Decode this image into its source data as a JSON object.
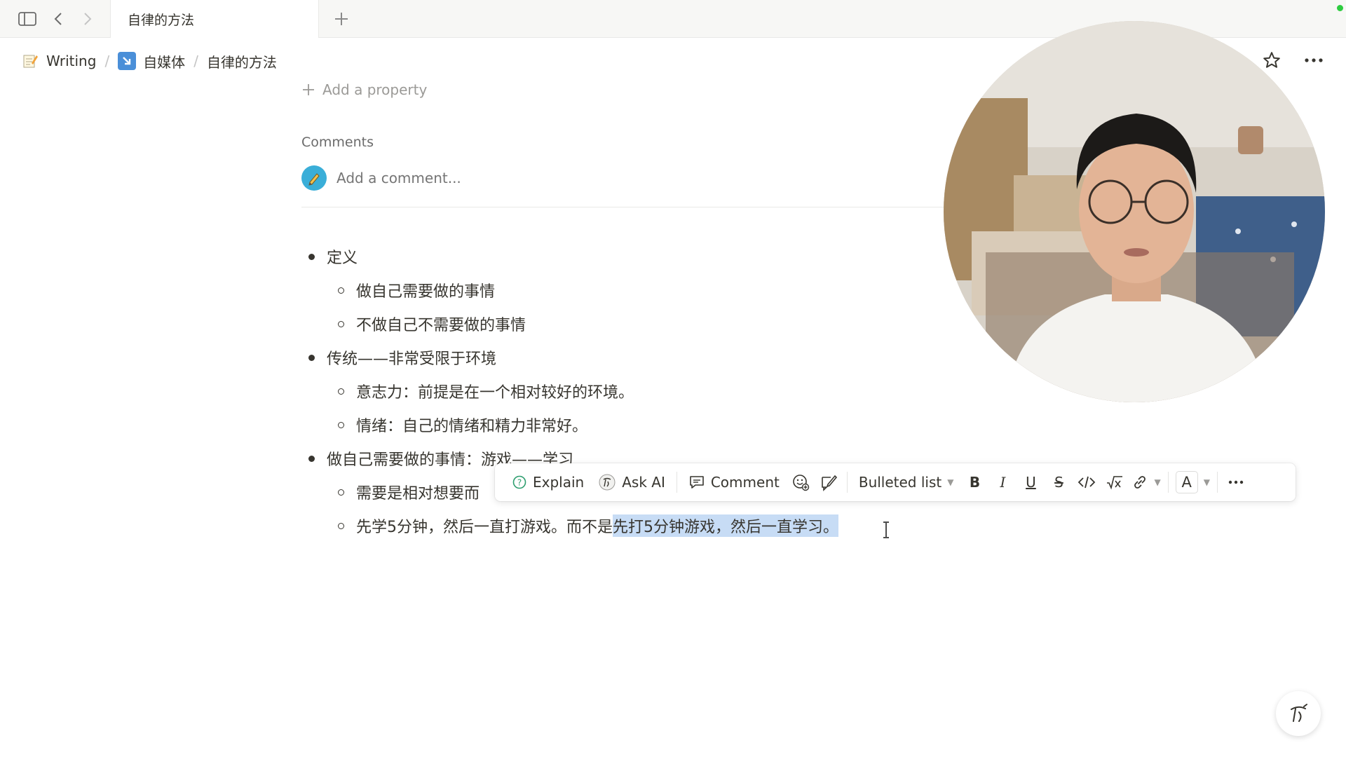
{
  "tab": {
    "title": "自律的方法"
  },
  "breadcrumb": [
    {
      "label": "Writing",
      "icon": "memo-icon"
    },
    {
      "label": "自媒体",
      "icon": "arrow-box-icon"
    },
    {
      "label": "自律的方法"
    }
  ],
  "properties": {
    "add_label": "Add a property"
  },
  "comments": {
    "label": "Comments",
    "placeholder": "Add a comment..."
  },
  "outline": {
    "item1": "定义",
    "item1_1": "做自己需要做的事情",
    "item1_2": "不做自己不需要做的事情",
    "item2": "传统——非常受限于环境",
    "item2_1": "意志力：前提是在一个相对较好的环境。",
    "item2_2": "情绪：自己的情绪和精力非常好。",
    "item3": "做自己需要做的事情：游戏——学习",
    "item3_1": "需要是相对想要而",
    "item3_2_plain": "先学5分钟，然后一直打游戏。而不是",
    "item3_2_selected": "先打5分钟游戏，然后一直学习。"
  },
  "toolbar": {
    "explain": "Explain",
    "ask_ai": "Ask AI",
    "comment": "Comment",
    "block_type": "Bulleted list",
    "bold": "B",
    "italic": "I",
    "underline": "U",
    "strike": "S",
    "color": "A"
  },
  "colors": {
    "selection": "#c7dcf5",
    "avatar": "#3aaed8",
    "status": "#2ecc40"
  }
}
